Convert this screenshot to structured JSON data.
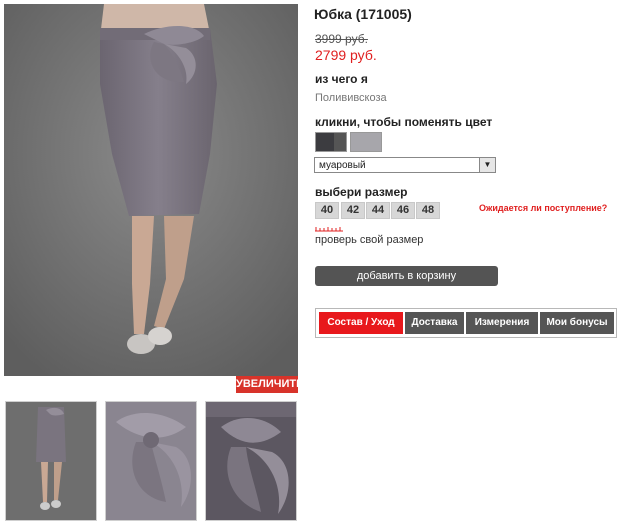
{
  "product": {
    "title": "Юбка (171005)",
    "old_price": "3999 руб.",
    "new_price": "2799 руб."
  },
  "material": {
    "label": "из чего я",
    "value": "Полививскоза"
  },
  "color": {
    "label": "кликни, чтобы поменять цвет",
    "selected": "муаровый",
    "swatches": [
      "#3c3c40",
      "#a7a6ab"
    ]
  },
  "size": {
    "label": "выбери размер",
    "options": [
      "40",
      "42",
      "44",
      "46",
      "48"
    ],
    "waiting_link": "Ожидается ли поступление?",
    "check_link": "проверь свой размер"
  },
  "actions": {
    "zoom": "УВЕЛИЧИТЬ",
    "add_to_cart": "добавить в корзину"
  },
  "tabs": [
    {
      "label": "Состав / Уход",
      "active": true
    },
    {
      "label": "Доставка",
      "active": false
    },
    {
      "label": "Измерения",
      "active": false
    },
    {
      "label": "Мои бонусы",
      "active": false
    }
  ],
  "colors": {
    "accent_red": "#e02020",
    "tab_active": "#e8181c",
    "tab_inactive": "#555555",
    "cart_button": "#545454"
  }
}
